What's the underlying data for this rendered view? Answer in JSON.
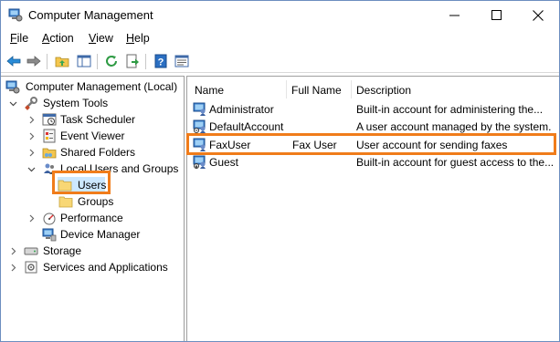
{
  "window": {
    "title": "Computer Management",
    "min_label": "—",
    "max_label": "☐",
    "close_label": "✕"
  },
  "menu": [
    {
      "accel": "F",
      "rest": "ile"
    },
    {
      "accel": "A",
      "rest": "ction"
    },
    {
      "accel": "V",
      "rest": "iew"
    },
    {
      "accel": "H",
      "rest": "elp"
    }
  ],
  "toolbar": {
    "icons": [
      "back-arrow-icon",
      "forward-arrow-icon",
      "up-folder-icon",
      "show-hide-console-tree-icon",
      "refresh-icon",
      "export-list-icon",
      "help-icon",
      "properties-icon"
    ]
  },
  "tree": {
    "root": "Computer Management (Local)",
    "system_tools": "System Tools",
    "task_scheduler": "Task Scheduler",
    "event_viewer": "Event Viewer",
    "shared_folders": "Shared Folders",
    "local_users_groups": "Local Users and Groups",
    "users": "Users",
    "groups": "Groups",
    "performance": "Performance",
    "device_manager": "Device Manager",
    "storage": "Storage",
    "services_apps": "Services and Applications"
  },
  "list": {
    "columns": {
      "name": "Name",
      "full_name": "Full Name",
      "description": "Description"
    },
    "rows": [
      {
        "name": "Administrator",
        "full_name": "",
        "description": "Built-in account for administering the..."
      },
      {
        "name": "DefaultAccount",
        "full_name": "",
        "description": "A user account managed by the system."
      },
      {
        "name": "FaxUser",
        "full_name": "Fax User",
        "description": "User account for sending faxes"
      },
      {
        "name": "Guest",
        "full_name": "",
        "description": "Built-in account for guest access to the..."
      }
    ]
  },
  "colors": {
    "highlight": "#f07c1a",
    "window_border": "#6c8ebf"
  }
}
